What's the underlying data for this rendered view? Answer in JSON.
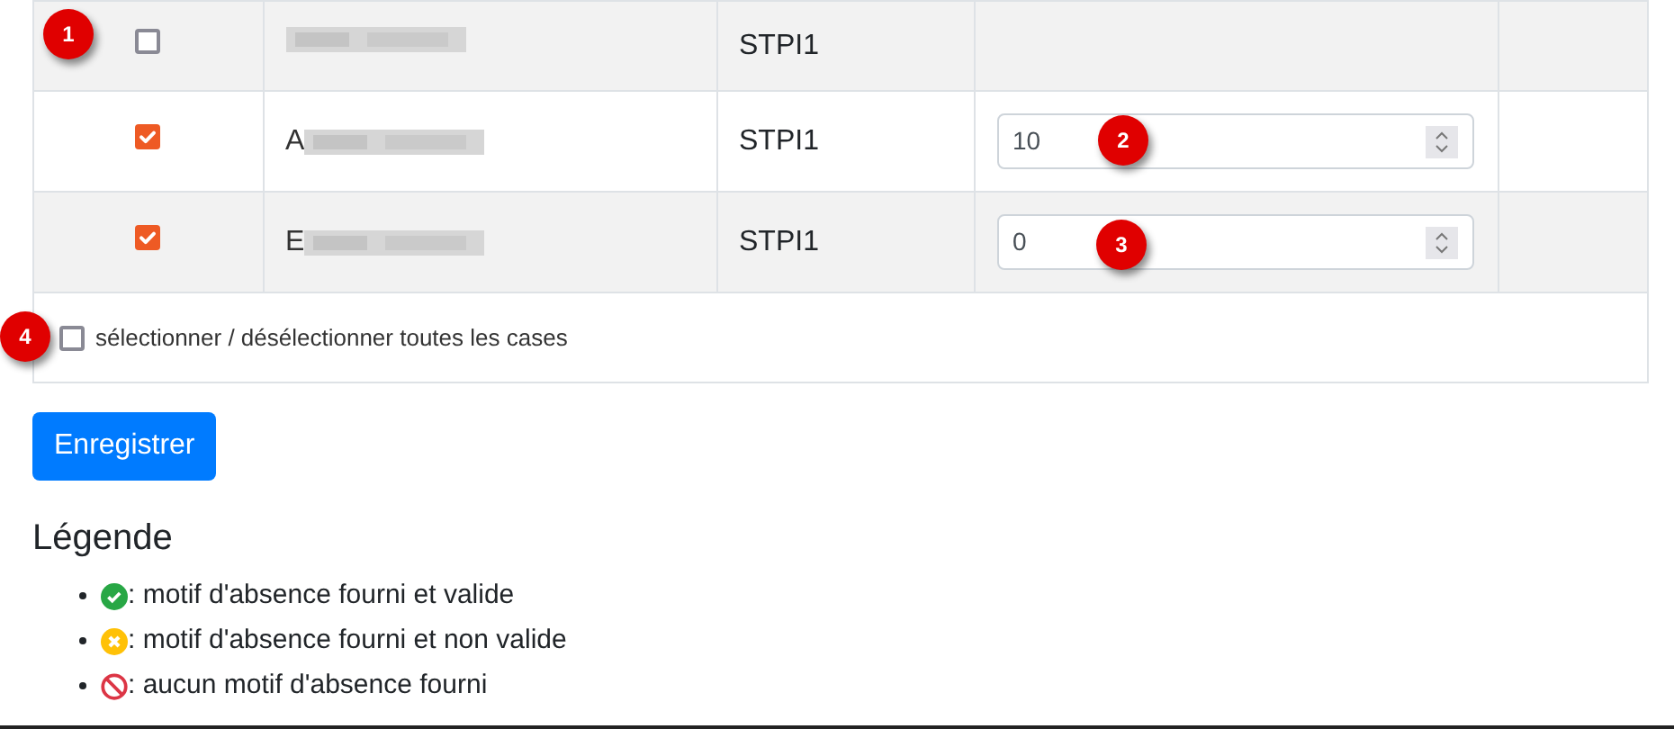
{
  "rows": [
    {
      "checked": false,
      "name_initial": "",
      "class": "STPI1",
      "input": null
    },
    {
      "checked": true,
      "name_initial": "A",
      "class": "STPI1",
      "input": {
        "value": "10"
      }
    },
    {
      "checked": true,
      "name_initial": "E",
      "class": "STPI1",
      "input": {
        "value": "0"
      }
    }
  ],
  "select_all": {
    "label": "sélectionner / désélectionner toutes les cases",
    "checked": false
  },
  "save_button": "Enregistrer",
  "legend": {
    "title": "Légende",
    "items": [
      {
        "kind": "valid",
        "text": ": motif d'absence fourni et valide"
      },
      {
        "kind": "invalid",
        "text": ": motif d'absence fourni et non valide"
      },
      {
        "kind": "none",
        "text": ": aucun motif d'absence fourni"
      }
    ]
  },
  "markers": [
    "1",
    "2",
    "3",
    "4"
  ]
}
